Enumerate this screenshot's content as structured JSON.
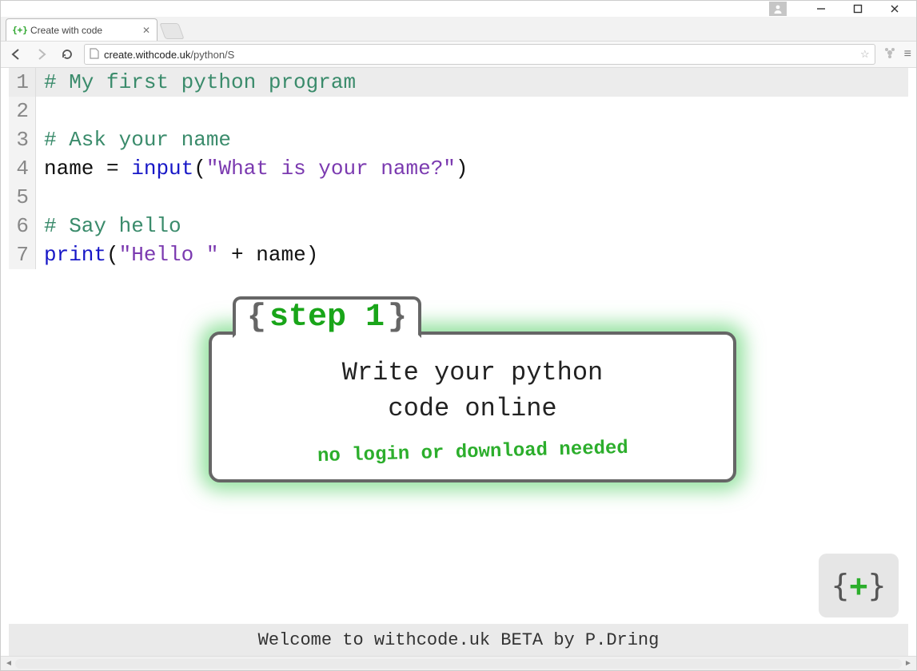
{
  "window": {
    "tab_title": "Create with code",
    "url_host": "create.withcode.uk",
    "url_path": "/python/S"
  },
  "editor": {
    "lines": [
      {
        "n": "1",
        "hl": true,
        "tokens": [
          {
            "cls": "tok-comment",
            "t": "# My first python program"
          }
        ]
      },
      {
        "n": "2",
        "hl": false,
        "tokens": []
      },
      {
        "n": "3",
        "hl": false,
        "tokens": [
          {
            "cls": "tok-comment",
            "t": "# Ask your name"
          }
        ]
      },
      {
        "n": "4",
        "hl": false,
        "tokens": [
          {
            "cls": "tok-name",
            "t": "name "
          },
          {
            "cls": "tok-op",
            "t": "= "
          },
          {
            "cls": "tok-builtin",
            "t": "input"
          },
          {
            "cls": "tok-paren",
            "t": "("
          },
          {
            "cls": "tok-string",
            "t": "\"What is your name?\""
          },
          {
            "cls": "tok-paren",
            "t": ")"
          }
        ]
      },
      {
        "n": "5",
        "hl": false,
        "tokens": []
      },
      {
        "n": "6",
        "hl": false,
        "tokens": [
          {
            "cls": "tok-comment",
            "t": "# Say hello"
          }
        ]
      },
      {
        "n": "7",
        "hl": false,
        "tokens": [
          {
            "cls": "tok-builtin",
            "t": "print"
          },
          {
            "cls": "tok-paren",
            "t": "("
          },
          {
            "cls": "tok-string",
            "t": "\"Hello \""
          },
          {
            "cls": "tok-op",
            "t": " + "
          },
          {
            "cls": "tok-name",
            "t": "name"
          },
          {
            "cls": "tok-paren",
            "t": ")"
          }
        ]
      }
    ]
  },
  "popup": {
    "step_label": "step 1",
    "body_line1": "Write your python",
    "body_line2": "code online",
    "sub": "no login or download needed"
  },
  "footer": {
    "text": "Welcome to withcode.uk BETA by P.Dring"
  },
  "icons": {
    "favicon": "{+}",
    "run": {
      "l": "{",
      "plus": "+",
      "r": "}"
    }
  }
}
